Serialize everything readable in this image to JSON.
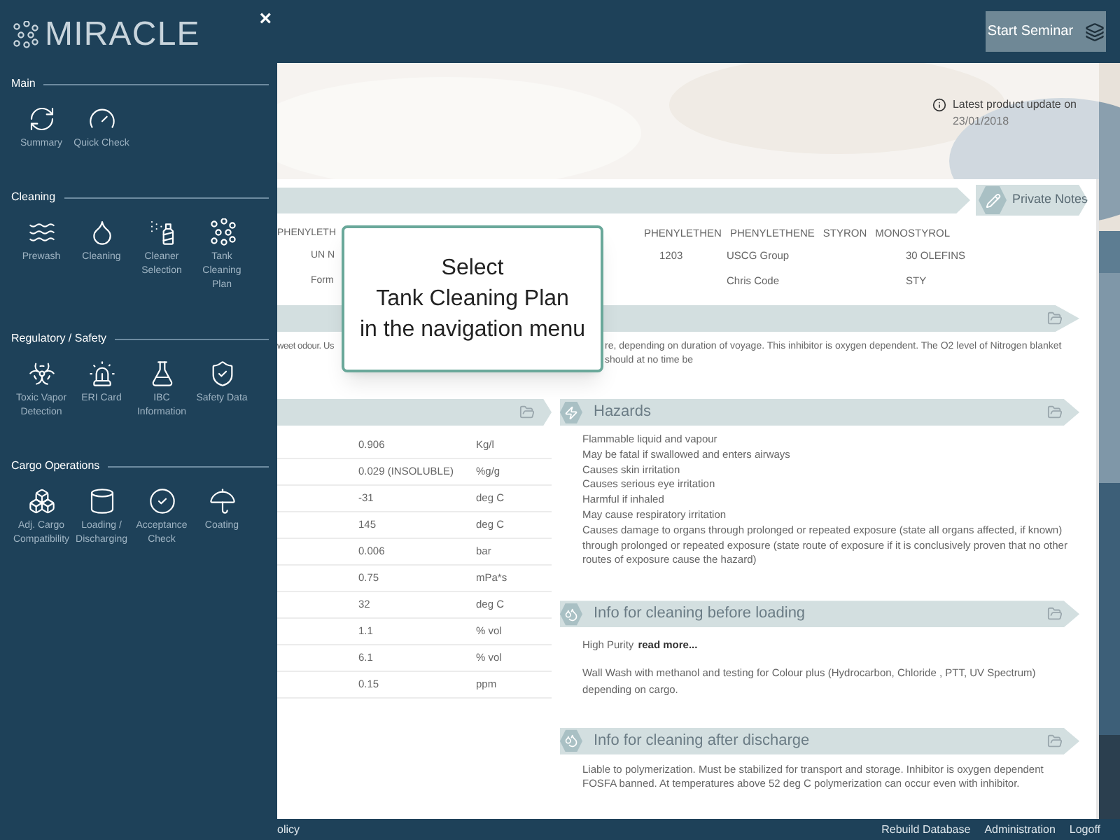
{
  "header": {
    "seminar_button": "Start Seminar"
  },
  "sidebar": {
    "logo": "MIRACLE",
    "close": "×",
    "sections": [
      {
        "title": "Main",
        "items": [
          "Summary",
          "Quick Check"
        ]
      },
      {
        "title": "Cleaning",
        "items": [
          "Prewash",
          "Cleaning",
          "Cleaner Selection",
          "Tank Cleaning Plan"
        ]
      },
      {
        "title": "Regulatory / Safety",
        "items": [
          "Toxic Vapor Detection",
          "ERI Card",
          "IBC Information",
          "Safety Data"
        ]
      },
      {
        "title": "Cargo Operations",
        "items": [
          "Adj. Cargo Compatibility",
          "Loading / Discharging",
          "Acceptance Check",
          "Coating"
        ]
      }
    ]
  },
  "banner": {
    "update_label": "Latest product update on",
    "update_date": "23/01/2018"
  },
  "product": {
    "private_notes": "Private Notes",
    "synonyms_left": [
      "PHENYLETH"
    ],
    "synonyms_right": [
      "PHENYLETHEN",
      "PHENYLETHENE",
      "STYRON",
      "MONOSTYROL"
    ],
    "fields": [
      {
        "label_cut": "UN N",
        "value": "1203",
        "label2": "USCG Group",
        "value2": "30 OLEFINS"
      },
      {
        "label_cut": "Form",
        "label2": "Chris Code",
        "value2": "STY"
      }
    ],
    "description_left": "weet odour. Us",
    "description_right": "re, depending on duration of voyage. This inhibitor is oxygen dependent. The O2 level of Nitrogen blanket should at no time be"
  },
  "properties": [
    {
      "value": "0.906",
      "unit": "Kg/l"
    },
    {
      "value": "0.029 (INSOLUBLE)",
      "unit": "%g/g"
    },
    {
      "value": "-31",
      "unit": "deg C"
    },
    {
      "value": "145",
      "unit": "deg C"
    },
    {
      "value": "0.006",
      "unit": "bar"
    },
    {
      "value": "0.75",
      "unit": "mPa*s"
    },
    {
      "value": "32",
      "unit": "deg C"
    },
    {
      "value": "1.1",
      "unit": "% vol"
    },
    {
      "value": "6.1",
      "unit": "% vol"
    },
    {
      "value": "0.15",
      "unit": "ppm"
    }
  ],
  "hazards": {
    "title": "Hazards",
    "lines": [
      "Flammable liquid and vapour",
      "May be fatal if swallowed and enters airways",
      "Causes skin irritation",
      "Causes serious eye irritation",
      "Harmful if inhaled",
      "May cause respiratory irritation",
      "Causes damage to organs through prolonged or repeated exposure (state all organs affected, if known) through prolonged or repeated exposure (state route of exposure if it is conclusively proven that no other routes of exposure cause the hazard)"
    ]
  },
  "cleaning_before": {
    "title": "Info for cleaning before loading",
    "purity": "High Purity",
    "read_more": "read more...",
    "wash": "Wall Wash with methanol and testing for Colour plus (Hydrocarbon, Chloride , PTT, UV Spectrum) depending on cargo."
  },
  "cleaning_after": {
    "title": "Info for cleaning after discharge",
    "text": "Liable to polymerization. Must be stabilized for transport and storage. Inhibitor is oxygen dependent FOSFA banned. At temperatures above 52 deg C polymerization can occur even with inhibitor."
  },
  "footer": {
    "left_cut": "olicy",
    "links": [
      "Rebuild Database",
      "Administration",
      "Logoff"
    ]
  },
  "tooltip": {
    "lines": [
      "Select",
      "Tank Cleaning Plan",
      "in the navigation menu"
    ]
  }
}
